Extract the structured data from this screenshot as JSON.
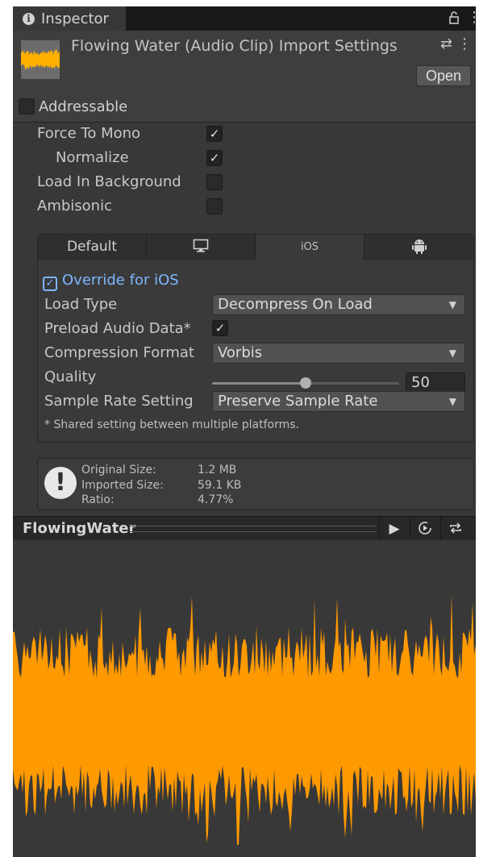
{
  "tab": {
    "label": "Inspector"
  },
  "header": {
    "title": "Flowing Water (Audio Clip) Import Settings",
    "open_label": "Open",
    "addressable_label": "Addressable",
    "addressable_checked": false
  },
  "clip_settings": [
    {
      "label": "Force To Mono",
      "checked": true
    },
    {
      "label": "Normalize",
      "checked": true
    },
    {
      "label": "Load In Background",
      "checked": false
    },
    {
      "label": "Ambisonic",
      "checked": false
    }
  ],
  "platform_tabs": [
    {
      "label": "Default",
      "icon": ""
    },
    {
      "label": "",
      "icon": "monitor-icon"
    },
    {
      "label": "iOS",
      "icon": "",
      "active": true
    },
    {
      "label": "",
      "icon": "android-icon"
    }
  ],
  "ios": {
    "override_label": "Override for iOS",
    "override_checked": true,
    "load_type_label": "Load Type",
    "load_type_value": "Decompress On Load",
    "preload_label": "Preload Audio Data*",
    "preload_checked": true,
    "compression_label": "Compression Format",
    "compression_value": "Vorbis",
    "quality_label": "Quality",
    "quality_value": "50",
    "quality_fraction": 0.5,
    "sample_rate_label": "Sample Rate Setting",
    "sample_rate_value": "Preserve Sample Rate",
    "note": "* Shared setting between multiple platforms."
  },
  "info": {
    "original_label": "Original Size:",
    "original_value": "1.2 MB",
    "imported_label": "Imported Size:",
    "imported_value": "59.1 KB",
    "ratio_label": "Ratio:",
    "ratio_value": "4.77%"
  },
  "preview": {
    "name": "FlowingWater",
    "waveform_color": "#ff9900"
  },
  "colors": {
    "accent_blue": "#7db6ff",
    "panel_bg": "#383838"
  }
}
